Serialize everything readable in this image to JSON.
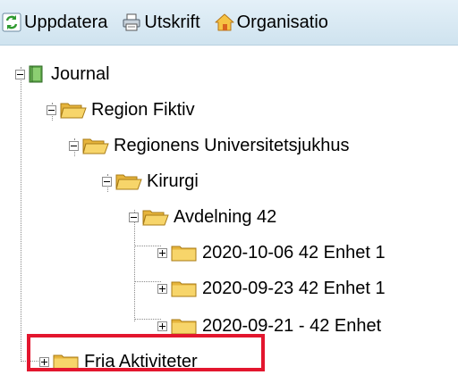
{
  "toolbar": {
    "buttons": [
      {
        "label": "Uppdatera",
        "icon": "refresh-icon"
      },
      {
        "label": "Utskrift",
        "icon": "printer-icon"
      },
      {
        "label": "Organisatio",
        "icon": "home-icon"
      }
    ]
  },
  "tree": {
    "root": {
      "label": "Journal",
      "icon": "book-icon",
      "expanded": true
    },
    "nodes": [
      {
        "label": "Region Fiktiv",
        "expanded": true,
        "open_folder": true
      },
      {
        "label": "Regionens Universitetsjukhus",
        "expanded": true,
        "open_folder": true
      },
      {
        "label": "Kirurgi",
        "expanded": true,
        "open_folder": true
      },
      {
        "label": "Avdelning 42",
        "expanded": true,
        "open_folder": true
      },
      {
        "label": "2020-10-06 42 Enhet 1",
        "expanded": false,
        "open_folder": false
      },
      {
        "label": "2020-09-23 42 Enhet 1",
        "expanded": false,
        "open_folder": false
      },
      {
        "label": "2020-09-21 - 42 Enhet",
        "expanded": false,
        "open_folder": false
      },
      {
        "label": "Fria Aktiviteter",
        "expanded": false,
        "open_folder": false,
        "highlighted": true
      }
    ]
  },
  "colors": {
    "highlight": "#e3162e",
    "toolbar_bg": "#d6e8f3",
    "folder": "#f2c94c"
  }
}
